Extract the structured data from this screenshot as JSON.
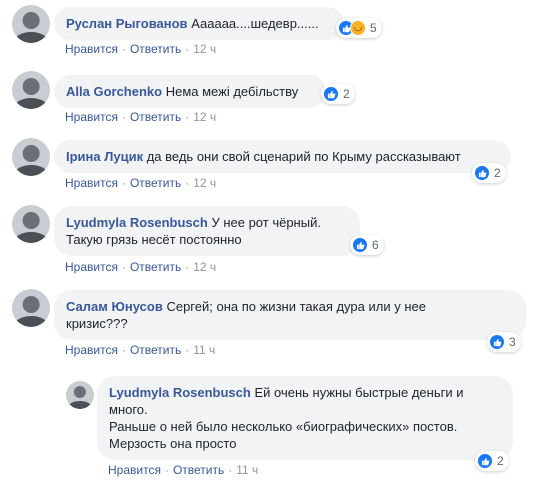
{
  "actions": {
    "like": "Нравится",
    "reply": "Ответить"
  },
  "colors": {
    "name": "#385898",
    "bubble": "#f2f3f5",
    "meta": "#90949c",
    "like": "#1877f2",
    "haha": "#f7b125"
  },
  "comments": [
    {
      "author": "Руслан Рыгованов",
      "text": "Аааааа....шедевр......",
      "time": "12 ч",
      "reactions": [
        "like",
        "haha"
      ],
      "count": "5"
    },
    {
      "author": "Alla Gorchenko",
      "text": "Нема межі дебільству",
      "time": "12 ч",
      "reactions": [
        "like"
      ],
      "count": "2"
    },
    {
      "author": "Ірина Луцик",
      "text": "да ведь они свой сценарий по Крыму рассказывают",
      "time": "12 ч",
      "reactions": [
        "like"
      ],
      "count": "2"
    },
    {
      "author": "Lyudmyla Rosenbusch",
      "text_lines": [
        "У нее рот чёрный.",
        "Такую грязь несёт постоянно"
      ],
      "time": "12 ч",
      "reactions": [
        "like"
      ],
      "count": "6"
    },
    {
      "author": "Салам Юнусов",
      "text_lines": [
        "Сергей; она по жизни такая дура или у нее",
        "кризис???"
      ],
      "time": "11 ч",
      "reactions": [
        "like"
      ],
      "count": "3"
    },
    {
      "author": "Lyudmyla Rosenbusch",
      "text_lines": [
        "Ей очень нужны быстрые деньги и",
        "много.",
        "Раньше о ней было несколько «биографических» постов.",
        "Мерзость она просто"
      ],
      "time": "11 ч",
      "reactions": [
        "like"
      ],
      "count": "2"
    }
  ]
}
